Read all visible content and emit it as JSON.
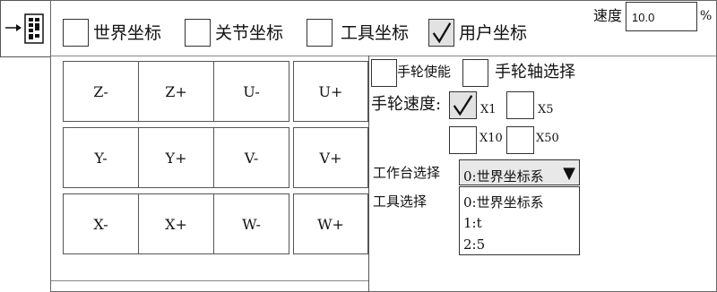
{
  "coords": [
    {
      "label": "世界坐标",
      "checked": false
    },
    {
      "label": "关节坐标",
      "checked": false
    },
    {
      "label": "工具坐标",
      "checked": false
    },
    {
      "label": "用户坐标",
      "checked": true
    }
  ],
  "speed": {
    "label": "速度",
    "value": "10.0",
    "unit": "%"
  },
  "jog_buttons": [
    "Z-",
    "Z+",
    "U-",
    "U+",
    "Y-",
    "Y+",
    "V-",
    "V+",
    "X-",
    "X+",
    "W-",
    "W+"
  ],
  "handwheel": {
    "enable_label": "手轮使能",
    "enable_checked": false,
    "axis_select_label": "手轮轴选择",
    "axis_select_checked": false,
    "speed_label": "手轮速度:",
    "options": [
      {
        "label": "X1",
        "checked": true
      },
      {
        "label": "X5",
        "checked": false
      },
      {
        "label": "X10",
        "checked": false
      },
      {
        "label": "X50",
        "checked": false
      }
    ]
  },
  "table_select": {
    "label": "工作台选择",
    "selected": "0:世界坐标系",
    "arrow": "▼"
  },
  "tool_select": {
    "label": "工具选择",
    "options": [
      "0:世界坐标系",
      "1:t",
      "2:5"
    ]
  },
  "icons": {
    "toggle": "arrow-right-icon",
    "panel": "grid-icon"
  }
}
